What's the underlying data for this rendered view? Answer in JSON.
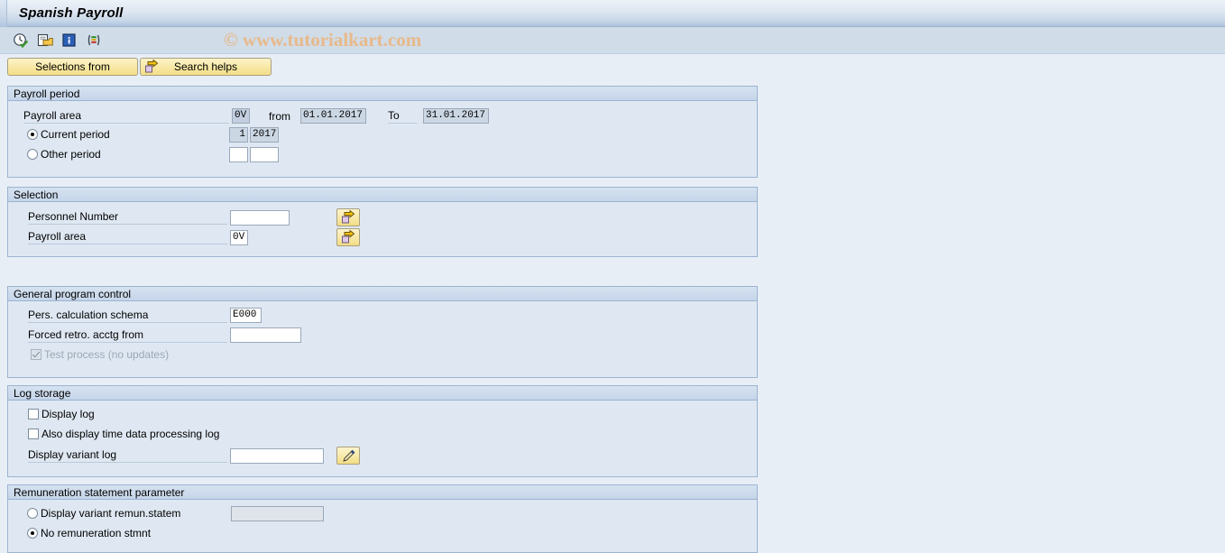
{
  "window": {
    "title": "Spanish Payroll"
  },
  "toolbar": {
    "icons": [
      {
        "name": "execute-clock-icon",
        "title": "Execute"
      },
      {
        "name": "variant-folder-icon",
        "title": "Get Variant"
      },
      {
        "name": "info-icon",
        "title": "Information"
      },
      {
        "name": "multicolor-list-icon",
        "title": "Selection Options"
      }
    ],
    "watermark": "© www.tutorialkart.com"
  },
  "buttons": {
    "selections_from": "Selections from",
    "search_helps": "Search helps"
  },
  "sections": {
    "payroll_period": {
      "title": "Payroll period",
      "payroll_area_label": "Payroll area",
      "payroll_area_value": "0V",
      "from_label": "from",
      "from_value": "01.01.2017",
      "to_label": "To",
      "to_value": "31.01.2017",
      "current_period_label": "Current period",
      "current_period_selected": true,
      "current_period_num": "1",
      "current_period_year": "2017",
      "other_period_label": "Other period",
      "other_period_selected": false,
      "other_period_num": "",
      "other_period_year": ""
    },
    "selection": {
      "title": "Selection",
      "personnel_number_label": "Personnel Number",
      "personnel_number_value": "",
      "personnel_number_multi_icon": "multi-selection-arrow-icon",
      "payroll_area_label": "Payroll area",
      "payroll_area_value": "0V",
      "payroll_area_multi_icon": "multi-selection-arrow-icon"
    },
    "general_program_control": {
      "title": "General program control",
      "schema_label": "Pers. calculation schema",
      "schema_value": "E000",
      "forced_retro_label": "Forced retro. acctg from",
      "forced_retro_value": "",
      "test_process_label": "Test process (no updates)",
      "test_process_checked": true,
      "test_process_disabled": true
    },
    "log_storage": {
      "title": "Log storage",
      "display_log_label": "Display log",
      "display_log_checked": false,
      "time_data_log_label": "Also display time data processing log",
      "time_data_log_checked": false,
      "display_variant_log_label": "Display variant log",
      "display_variant_log_value": "",
      "display_variant_log_icon": "pencil-edit-icon"
    },
    "remuneration": {
      "title": "Remuneration statement parameter",
      "display_variant_label": "Display variant remun.statem",
      "display_variant_selected": false,
      "display_variant_value": "",
      "no_remuneration_label": "No remuneration stmnt",
      "no_remuneration_selected": true
    }
  },
  "colors": {
    "page_bg": "#e8eef6",
    "panel_bg": "#dfe8f2",
    "panel_border": "#9bb4d2",
    "button_yellow": "#f8e9a8",
    "watermark": "#e8b98a",
    "toolbar_bg": "#d0dce8"
  }
}
